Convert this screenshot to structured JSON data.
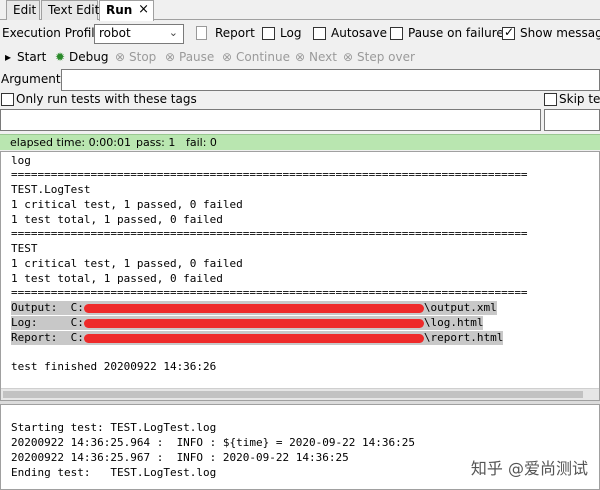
{
  "tabs": [
    {
      "label": "Edit"
    },
    {
      "label": "Text Edit"
    },
    {
      "label": "Run",
      "active": true
    }
  ],
  "tab_close": "×",
  "profile": {
    "label": "Execution Profile:",
    "value": "robot",
    "options_visible": [
      "Report",
      "Log",
      "Autosave",
      "Pause on failure",
      "Show message"
    ],
    "report": "Report",
    "log": "Log",
    "autosave": "Autosave",
    "pause_on_failure": "Pause on failure",
    "show_message": "Show message"
  },
  "run_buttons": {
    "start": "Start",
    "debug": "Debug",
    "stop": "Stop",
    "pause": "Pause",
    "continue": "Continue",
    "next": "Next",
    "step_over": "Step over"
  },
  "arguments": {
    "label": "Arguments:",
    "value": ""
  },
  "tags": {
    "only_run": "Only run tests with these tags",
    "skip": "Skip test"
  },
  "status": {
    "elapsed": "elapsed time: 0:00:01",
    "pass": "pass: 1",
    "fail": "fail: 0",
    "color": "#b9e6b0"
  },
  "console": {
    "lines": [
      "log",
      "==============================================================================",
      "TEST.LogTest",
      "1 critical test, 1 passed, 0 failed",
      "1 test total, 1 passed, 0 failed",
      "==============================================================================",
      "TEST",
      "1 critical test, 1 passed, 0 failed",
      "1 test total, 1 passed, 0 failed",
      "=============================================================================="
    ],
    "output_label": "Output:  C:",
    "output_tail": "\\output.xml",
    "log_label": "Log:     C:",
    "log_tail": "\\log.html",
    "report_label": "Report:  C:",
    "report_tail": "\\report.html",
    "finished": "test finished 20200922 14:36:26"
  },
  "message_log": [
    "Starting test: TEST.LogTest.log",
    "20200922 14:36:25.964 :  INFO : ${time} = 2020-09-22 14:36:25",
    "20200922 14:36:25.967 :  INFO : 2020-09-22 14:36:25",
    "Ending test:   TEST.LogTest.log"
  ],
  "watermark": "知乎 @爱尚测试"
}
